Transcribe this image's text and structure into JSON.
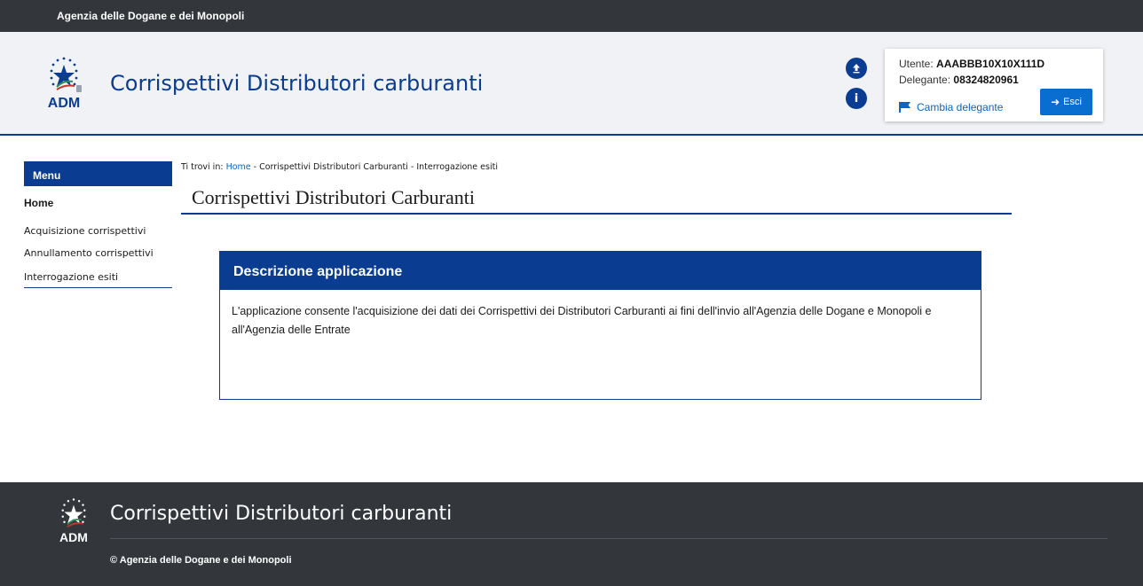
{
  "topbar": {
    "agency": "Agenzia delle Dogane e dei Monopoli"
  },
  "header": {
    "logo_text": "ADM",
    "app_title": "Corrispettivi Distributori carburanti",
    "user_label": "Utente: ",
    "user_value": "AAABBB10X10X111D",
    "delegate_label": "Delegante: ",
    "delegate_value": "08324820961",
    "change_delegate": "Cambia delegante",
    "logout": "Esci"
  },
  "menu": {
    "title": "Menu",
    "items": [
      {
        "label": "Home"
      },
      {
        "label": "Acquisizione corrispettivi"
      },
      {
        "label": "Annullamento corrispettivi"
      },
      {
        "label": "Interrogazione esiti"
      }
    ]
  },
  "breadcrumb": {
    "prefix": "Ti trovi in: ",
    "home": "Home",
    "sep1": " -  ",
    "level2": "Corrispettivi Distributori Carburanti",
    "sep2": " -  ",
    "level3": "Interrogazione esiti"
  },
  "main": {
    "title": "Corrispettivi Distributori Carburanti",
    "card_title": "Descrizione applicazione",
    "card_body": "L'applicazione consente l'acquisizione dei dati dei Corrispettivi dei Distributori Carburanti ai fini dell'invio all'Agenzia delle Dogane e Monopoli e all'Agenzia delle Entrate"
  },
  "footer": {
    "logo_text": "ADM",
    "title": "Corrispettivi Distributori carburanti",
    "copyright": "© Agenzia delle Dogane e dei Monopoli"
  },
  "colors": {
    "brand_blue": "#0a3d91",
    "dark_bar": "#33373c",
    "link_blue": "#0a66c2",
    "button_blue": "#0a6ed1"
  },
  "icons": {
    "upload": "upload-circle-icon",
    "info": "info-circle-icon",
    "flag": "flag-icon",
    "logout": "sign-in-arrow-icon"
  }
}
